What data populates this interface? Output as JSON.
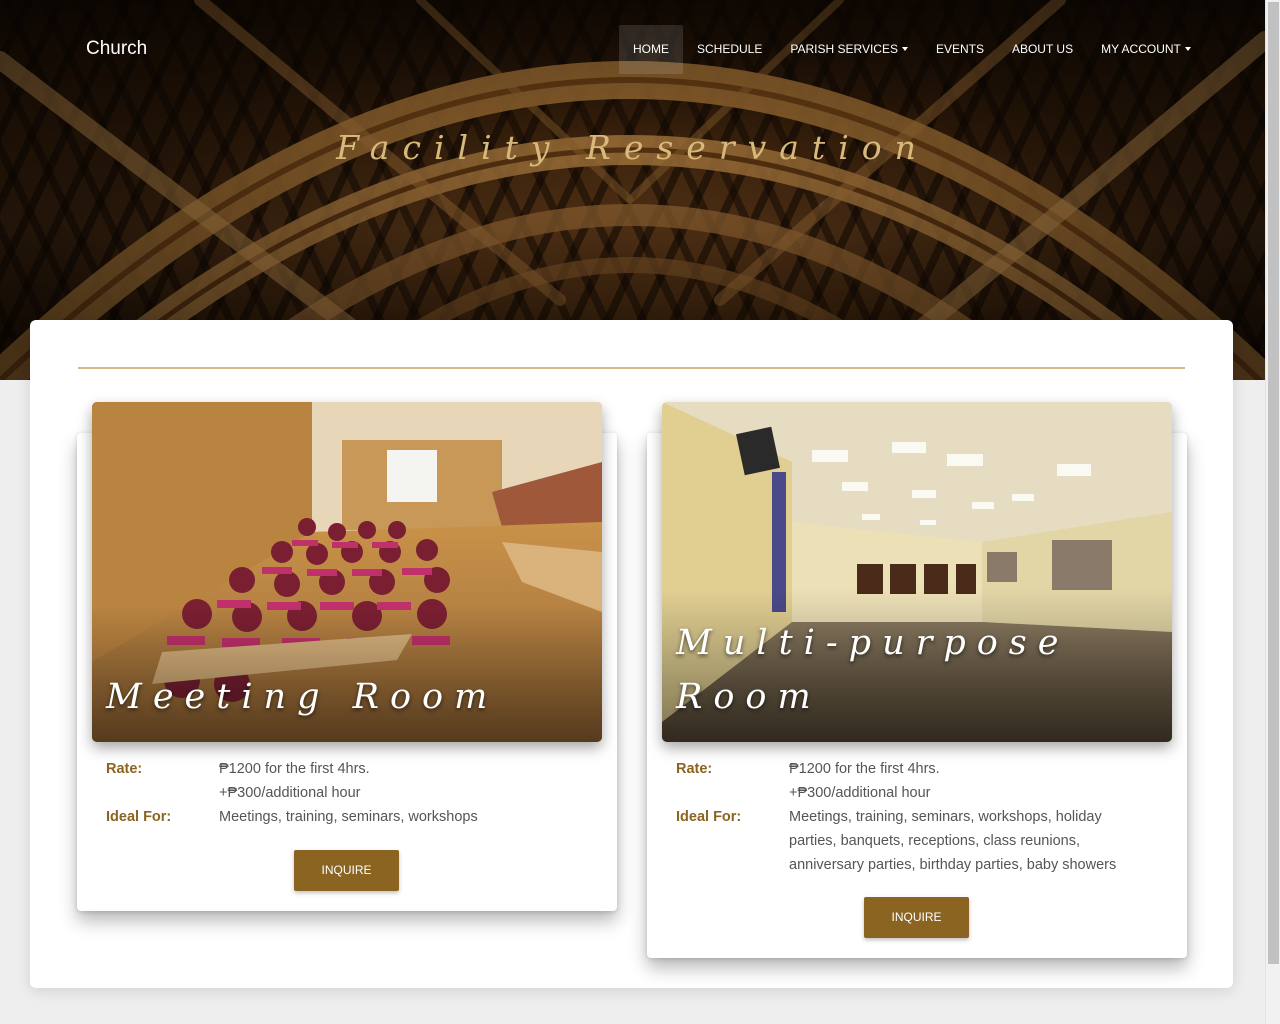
{
  "nav": {
    "brand": "Church",
    "items": [
      {
        "label": "HOME",
        "active": true,
        "dropdown": false
      },
      {
        "label": "SCHEDULE",
        "active": false,
        "dropdown": false
      },
      {
        "label": "PARISH SERVICES",
        "active": false,
        "dropdown": true
      },
      {
        "label": "EVENTS",
        "active": false,
        "dropdown": false
      },
      {
        "label": "ABOUT US",
        "active": false,
        "dropdown": false
      },
      {
        "label": "MY ACCOUNT",
        "active": false,
        "dropdown": true
      }
    ]
  },
  "hero": {
    "title": "Facility Reservation"
  },
  "rooms": [
    {
      "name": "Meeting Room",
      "rate_label": "Rate:",
      "rate_line1": "₱1200 for the first 4hrs.",
      "rate_line2": "+₱300/additional hour",
      "ideal_label": "Ideal For:",
      "ideal_value": "Meetings, training, seminars, workshops",
      "button_label": "INQUIRE"
    },
    {
      "name": "Multi-purpose Room",
      "rate_label": "Rate:",
      "rate_line1": "₱1200 for the first 4hrs.",
      "rate_line2": "+₱300/additional hour",
      "ideal_label": "Ideal For:",
      "ideal_value": "Meetings, training, seminars, workshops, holiday parties, banquets, receptions, class reunions, anniversary parties, birthday parties, baby showers",
      "button_label": "INQUIRE"
    }
  ],
  "colors": {
    "accent": "#8a6420",
    "hero_title": "#d8b97c",
    "divider": "#d4b98a"
  }
}
